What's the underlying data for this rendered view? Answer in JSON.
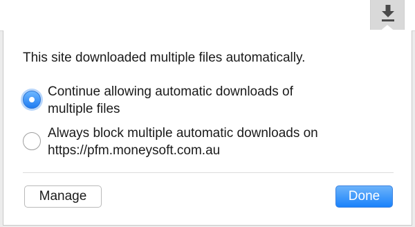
{
  "toolbar": {
    "download_icon": "download-arrow-icon"
  },
  "bubble": {
    "title": "This site downloaded multiple files automatically.",
    "options": [
      {
        "label_line1": "Continue allowing automatic downloads of",
        "label_line2": "multiple files",
        "selected": true
      },
      {
        "label_line1": "Always block multiple automatic downloads on",
        "label_line2": "https://pfm.moneysoft.com.au",
        "selected": false
      }
    ],
    "manage_label": "Manage",
    "done_label": "Done"
  },
  "colors": {
    "accent": "#1a82fb",
    "radio_selected": "#1f7cf2"
  }
}
